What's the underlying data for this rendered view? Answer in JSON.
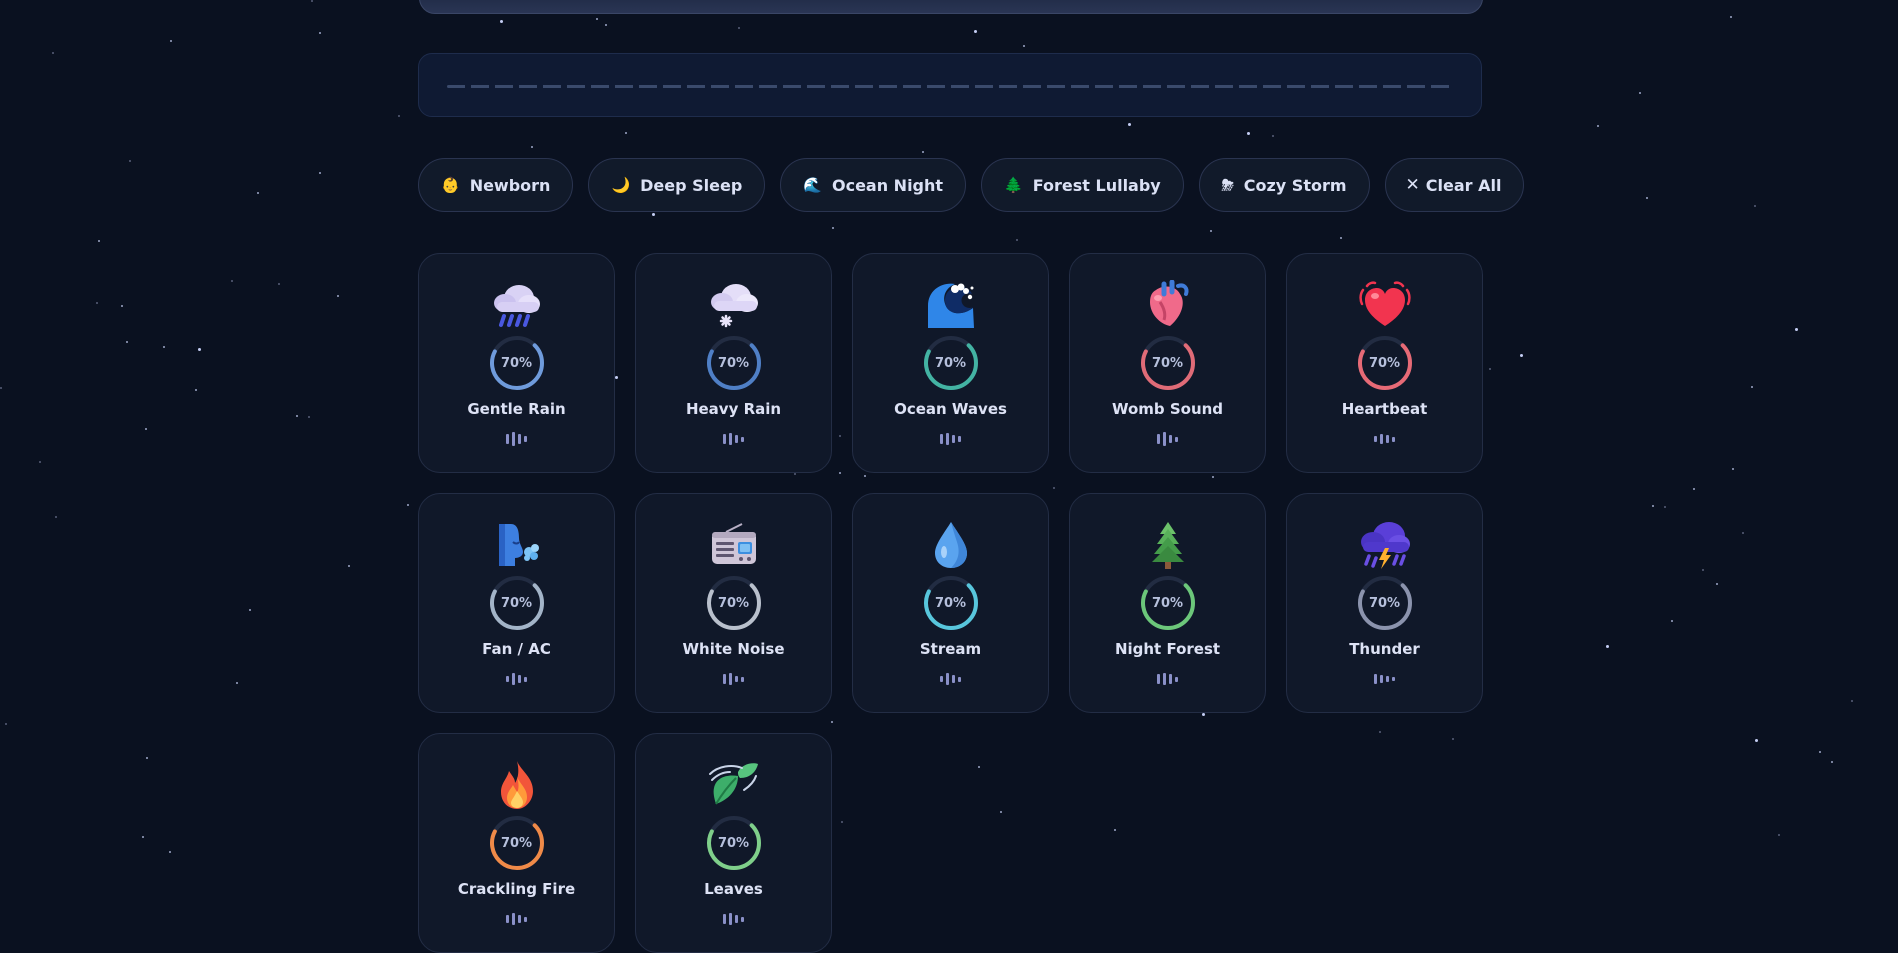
{
  "presets": [
    {
      "icon": "👶",
      "icon_name": "baby-icon",
      "label": "Newborn"
    },
    {
      "icon": "🌙",
      "icon_name": "crescent-moon-icon",
      "label": "Deep Sleep"
    },
    {
      "icon": "🌊",
      "icon_name": "wave-icon",
      "label": "Ocean Night"
    },
    {
      "icon": "🌲",
      "icon_name": "tree-icon",
      "label": "Forest Lullaby"
    },
    {
      "icon": "⛈",
      "icon_name": "storm-icon",
      "label": "Cozy Storm"
    }
  ],
  "clear_all": {
    "icon": "✕",
    "label": "Clear All"
  },
  "sounds": [
    {
      "name": "Gentle Rain",
      "icon": "rain-cloud-icon",
      "volume_label": "70%",
      "volume": 0.7,
      "color": "#6f9bdc"
    },
    {
      "name": "Heavy Rain",
      "icon": "snow-cloud-icon",
      "volume_label": "70%",
      "volume": 0.7,
      "color": "#4f7fc6"
    },
    {
      "name": "Ocean Waves",
      "icon": "wave-icon",
      "volume_label": "70%",
      "volume": 0.7,
      "color": "#43b3a3"
    },
    {
      "name": "Womb Sound",
      "icon": "anatomical-heart-icon",
      "volume_label": "70%",
      "volume": 0.7,
      "color": "#e06b77"
    },
    {
      "name": "Heartbeat",
      "icon": "beating-heart-icon",
      "volume_label": "70%",
      "volume": 0.7,
      "color": "#e76a76"
    },
    {
      "name": "Fan / AC",
      "icon": "wind-face-icon",
      "volume_label": "70%",
      "volume": 0.7,
      "color": "#a3b4c8"
    },
    {
      "name": "White Noise",
      "icon": "radio-icon",
      "volume_label": "70%",
      "volume": 0.7,
      "color": "#b9c0cc"
    },
    {
      "name": "Stream",
      "icon": "droplet-icon",
      "volume_label": "70%",
      "volume": 0.7,
      "color": "#58c6dc"
    },
    {
      "name": "Night Forest",
      "icon": "evergreen-tree-icon",
      "volume_label": "70%",
      "volume": 0.7,
      "color": "#6cc77a"
    },
    {
      "name": "Thunder",
      "icon": "thunder-cloud-icon",
      "volume_label": "70%",
      "volume": 0.7,
      "color": "#8b93ad"
    },
    {
      "name": "Crackling Fire",
      "icon": "fire-icon",
      "volume_label": "70%",
      "volume": 0.7,
      "color": "#f08a48"
    },
    {
      "name": "Leaves",
      "icon": "leaf-wind-icon",
      "volume_label": "70%",
      "volume": 0.7,
      "color": "#7fcf8a"
    }
  ]
}
